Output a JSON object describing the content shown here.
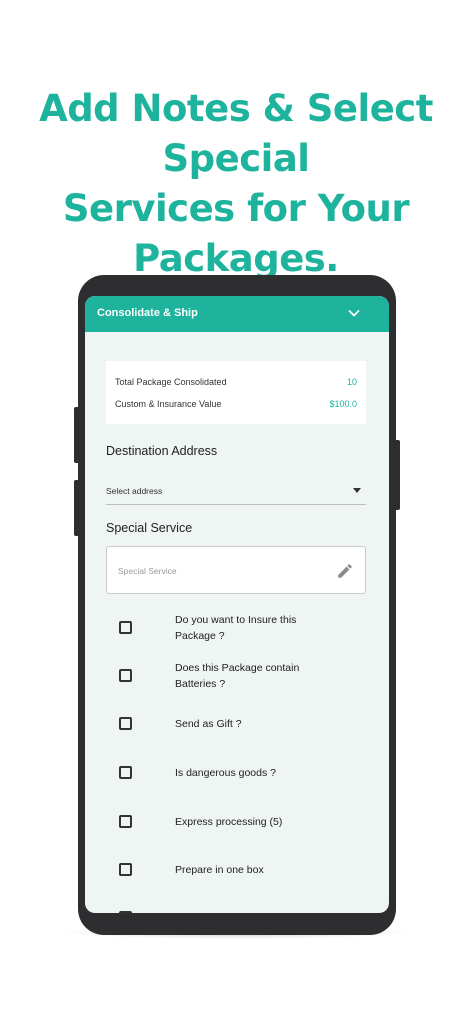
{
  "headline": {
    "line1": "Add Notes & Select Special",
    "line2": "Services for Your Packages."
  },
  "appbar": {
    "title": "Consolidate & Ship",
    "collapse_icon": "chevron-down-icon"
  },
  "summary": {
    "rows": [
      {
        "label": "Total Package Consolidated",
        "value": "10"
      },
      {
        "label": "Custom & Insurance Value",
        "value": "$100.0"
      }
    ]
  },
  "destination": {
    "title": "Destination Address",
    "select_value": "Select address"
  },
  "special_service": {
    "title": "Special Service",
    "placeholder": "Special Service",
    "edit_icon": "pencil-icon"
  },
  "options": [
    {
      "label": "Do you want to Insure this Package ?",
      "checked": false
    },
    {
      "label": "Does this Package contain Batteries ?",
      "checked": false
    },
    {
      "label": "Send as Gift ?",
      "checked": false
    },
    {
      "label": "Is dangerous goods ?",
      "checked": false
    },
    {
      "label": "Express processing (5)",
      "checked": false
    },
    {
      "label": "Prepare in one box",
      "checked": false
    }
  ],
  "colors": {
    "accent": "#1db39c",
    "screen_bg": "#eef5f2",
    "phone_body": "#2e2e31"
  }
}
